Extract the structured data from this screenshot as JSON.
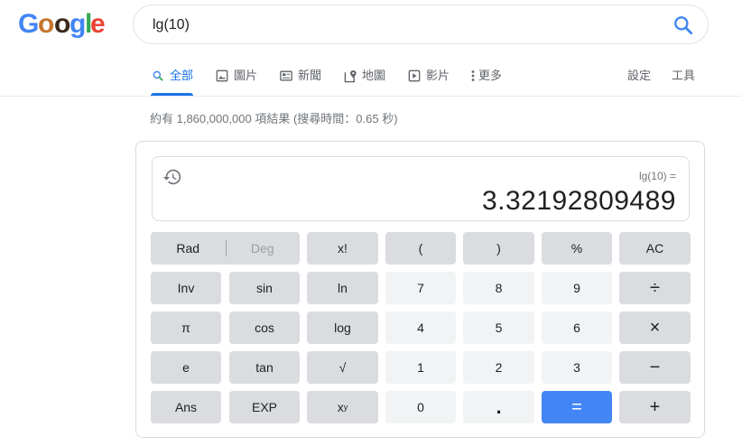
{
  "logo": {
    "letters": [
      "G",
      "o",
      "o",
      "g",
      "l",
      "e"
    ],
    "colors": [
      "#4285f4",
      "#ea4335",
      "#fbbc05",
      "#4285f4",
      "#34a853",
      "#ea4335"
    ]
  },
  "search": {
    "query": "lg(10)",
    "placeholder": ""
  },
  "tabs": [
    {
      "label": "全部",
      "icon": "search-icon",
      "active": true
    },
    {
      "label": "圖片",
      "icon": "image-icon"
    },
    {
      "label": "新聞",
      "icon": "news-icon"
    },
    {
      "label": "地圖",
      "icon": "map-icon"
    },
    {
      "label": "影片",
      "icon": "video-icon"
    },
    {
      "label": "更多",
      "icon": "more-vert-icon"
    }
  ],
  "tools": {
    "settings": "設定",
    "tools": "工具"
  },
  "stats": "約有 1,860,000,000 項結果 (搜尋時間：0.65 秒)",
  "calculator": {
    "expression": "lg(10) =",
    "result": "3.32192809489",
    "rad": "Rad",
    "deg": "Deg",
    "keys": {
      "fact": "x!",
      "lparen": "(",
      "rparen": ")",
      "percent": "%",
      "ac": "AC",
      "inv": "Inv",
      "sin": "sin",
      "ln": "ln",
      "seven": "7",
      "eight": "8",
      "nine": "9",
      "divide": "÷",
      "pi": "π",
      "cos": "cos",
      "log": "log",
      "four": "4",
      "five": "5",
      "six": "6",
      "multiply": "×",
      "e": "e",
      "tan": "tan",
      "sqrt": "√",
      "one": "1",
      "two": "2",
      "three": "3",
      "minus": "−",
      "ans": "Ans",
      "exp": "EXP",
      "pow_base": "x",
      "pow_exp": "y",
      "zero": "0",
      "dot": ".",
      "equals": "=",
      "plus": "+"
    }
  },
  "colors": {
    "accent": "#1a73e8",
    "equals": "#4285f4",
    "dark_key": "#dadce0",
    "light_key": "#f1f3f4"
  }
}
